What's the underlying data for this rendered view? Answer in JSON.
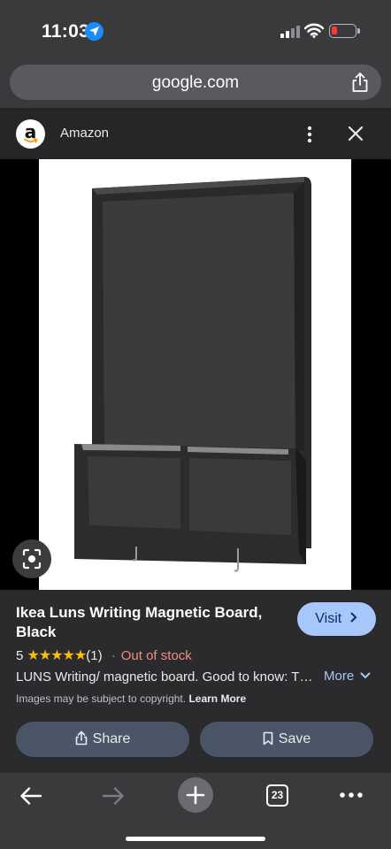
{
  "status_bar": {
    "time": "11:03",
    "icons": [
      "location-icon",
      "signal-icon",
      "wifi-icon",
      "battery-low-icon"
    ],
    "battery_color": "#ff3b30"
  },
  "browser": {
    "url": "google.com",
    "tab_count": "23"
  },
  "source": {
    "name": "Amazon",
    "logo_letter": "a"
  },
  "product": {
    "title": "Ikea Luns Writing Magnetic Board, Black",
    "rating": "5",
    "stars": "★★★★★",
    "review_count": "(1)",
    "separator": "·",
    "stock": "Out of stock",
    "description": "LUNS Writing/ magnetic board. Good to know: The bottom shelf",
    "more_label": "More",
    "copyright": "Images may be subject to copyright.",
    "learn_more": "Learn More"
  },
  "actions": {
    "visit": "Visit",
    "share": "Share",
    "save": "Save"
  },
  "colors": {
    "accent": "#a8c7fa",
    "stock_red": "#f28b82",
    "star": "#fbbc04"
  }
}
